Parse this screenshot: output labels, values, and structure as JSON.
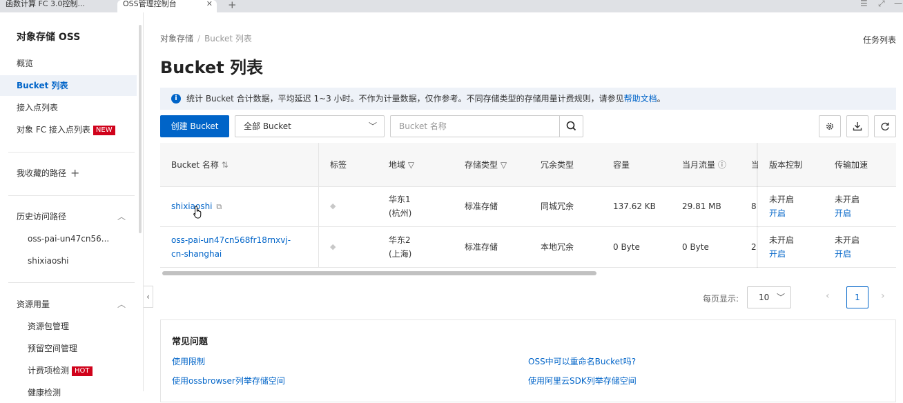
{
  "browser": {
    "tabs": [
      {
        "label": "函数计算 FC 3.0控制..."
      },
      {
        "label": "OSS管理控制台"
      }
    ]
  },
  "sidebar": {
    "title": "对象存储 OSS",
    "items": [
      {
        "label": "概览"
      },
      {
        "label": "Bucket 列表"
      },
      {
        "label": "接入点列表"
      },
      {
        "label": "对象 FC 接入点列表",
        "badge": "NEW"
      }
    ],
    "favorites": {
      "label": "我收藏的路径"
    },
    "history": {
      "label": "历史访问路径",
      "items": [
        {
          "label": "oss-pai-un47cn56..."
        },
        {
          "label": "shixiaoshi"
        }
      ]
    },
    "resources": {
      "label": "资源用量",
      "items": [
        {
          "label": "资源包管理"
        },
        {
          "label": "预留空间管理"
        },
        {
          "label": "计费项检测",
          "badge": "HOT"
        },
        {
          "label": "健康检测"
        }
      ]
    },
    "badge_colors": {
      "new": "#d0021b",
      "hot": "#d0021b"
    }
  },
  "header": {
    "breadcrumb": [
      "对象存储",
      "Bucket 列表"
    ],
    "title": "Bucket 列表",
    "task_list": "任务列表"
  },
  "notice": {
    "text": "统计 Bucket 合计数据，平均延迟 1~3 小时。不作为计量数据，仅作参考。不同存储类型的存储用量计费规则，请参见",
    "link": "帮助文档",
    "suffix": "。"
  },
  "toolbar": {
    "create_label": "创建 Bucket",
    "filter_value": "全部 Bucket",
    "search_placeholder": "Bucket 名称"
  },
  "table": {
    "columns": {
      "name": "Bucket 名称",
      "tags": "标签",
      "region": "地域",
      "storage": "存储类型",
      "redundancy": "冗余类型",
      "capacity": "容量",
      "traffic": "当月流量",
      "more": "当",
      "versioning": "版本控制",
      "acceleration": "传输加速"
    },
    "rows": [
      {
        "name": "shixiaoshi",
        "region_1": "华东1",
        "region_2": "(杭州)",
        "storage": "标准存储",
        "redundancy": "同城冗余",
        "capacity": "137.62 KB",
        "traffic": "29.81 MB",
        "more": "8",
        "versioning_status": "未开启",
        "versioning_action": "开启",
        "accel_status": "未开启",
        "accel_action": "开启"
      },
      {
        "name_1": "oss-pai-un47cn568fr18rnxvj-",
        "name_2": "cn-shanghai",
        "region_1": "华东2",
        "region_2": "(上海)",
        "storage": "标准存储",
        "redundancy": "本地冗余",
        "capacity": "0 Byte",
        "traffic": "0 Byte",
        "more": "2",
        "versioning_status": "未开启",
        "versioning_action": "开启",
        "accel_status": "未开启",
        "accel_action": "开启"
      }
    ]
  },
  "pagination": {
    "label": "每页显示:",
    "page_size": "10",
    "current": "1"
  },
  "faq": {
    "title": "常见问题",
    "links": [
      "使用限制",
      "OSS中可以重命名Bucket吗?",
      "使用ossbrowser列举存储空间",
      "使用阿里云SDK列举存储空间"
    ]
  },
  "colors": {
    "primary": "#0064c8",
    "notice_bg": "#eef2f8"
  }
}
